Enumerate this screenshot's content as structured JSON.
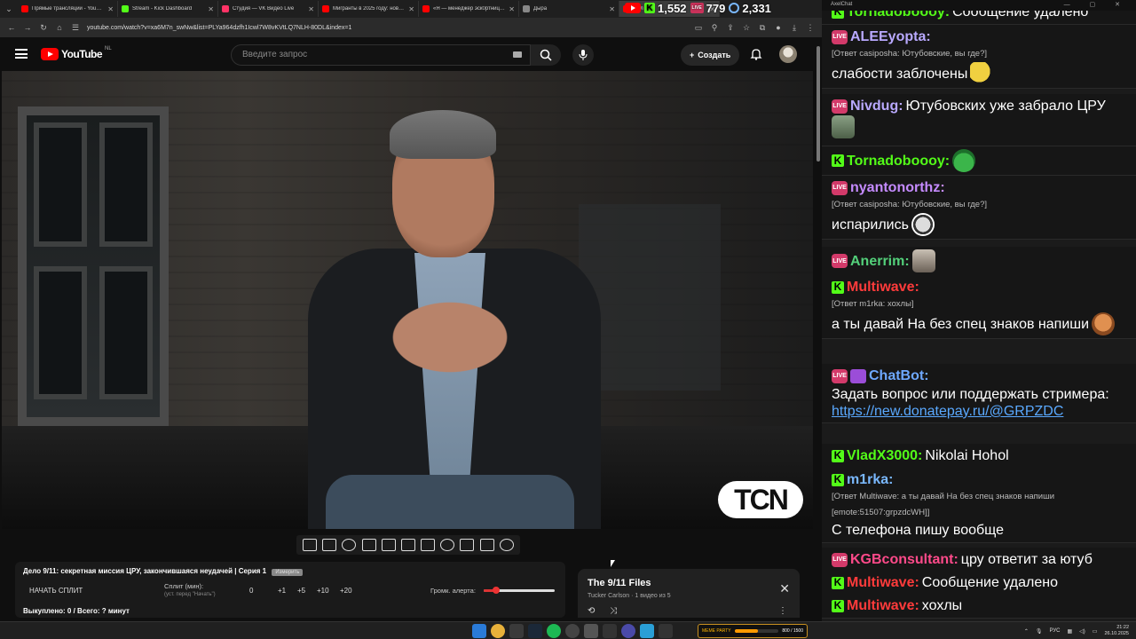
{
  "browser": {
    "tabs": [
      {
        "title": "Прямые трансляции - YouTube",
        "color": "#ff0000"
      },
      {
        "title": "Stream - Kick Dashboard",
        "color": "#53fc18"
      },
      {
        "title": "Студия — VK Видео Live",
        "color": "#ff3366"
      },
      {
        "title": "Мигранты в 2025 году: новы...",
        "color": "#ff0000"
      },
      {
        "title": "«Я — менеджер эск0ртниц»...",
        "color": "#ff0000"
      },
      {
        "title": "Дыра",
        "color": "#888888"
      },
      {
        "title": "Дел",
        "color": "#ff0000"
      }
    ],
    "url": "youtube.com/watch?v=xa6M7n_swNw&list=PLYa964dzfh1Icwl7W8vKVtLQ7NLH-80DL&index=1"
  },
  "youtube": {
    "logo_text": "YouTube",
    "region": "NL",
    "search_placeholder": "Введите запрос",
    "create_label": "Создать",
    "notifications_count": "116"
  },
  "video": {
    "watermark": "TCN"
  },
  "stream_stats": {
    "kick_viewers": "1,552",
    "vk_viewers": "779",
    "yt_viewers": "2,331"
  },
  "split_panel": {
    "title": "Дело 9/11: секретная миссия ЦРУ, закончившаяся неудачей | Серия 1",
    "badge": "Измерить",
    "start_button": "НАЧАТЬ СПЛИТ",
    "split_label": "Сплит (мин):",
    "split_sub": "(уст. перед \"Начать\")",
    "split_values": [
      "0",
      "+1",
      "+5",
      "+10",
      "+20"
    ],
    "alert_volume_label": "Громк. алерта:",
    "alert_volume": 0.18,
    "footer": "Выкуплено: 0 / Всего: ? минут"
  },
  "playlist": {
    "title": "The 9/11 Files",
    "subtitle": "Tucker Carlson · 1 видео из 5"
  },
  "chat": {
    "window_title": "AxelChat",
    "messages": [
      {
        "platform": "kick",
        "user": "Tornadobooоy:",
        "user_color": "#53fc18",
        "text": "Сообщение удалено"
      },
      {
        "platform": "live",
        "user": "ALEEyopta:",
        "user_color": "#b9a9ff",
        "reply": "[Ответ casiposha: Ютубовские, вы где?]",
        "text": "слабости заблочены",
        "emote": "pac"
      },
      {
        "platform": "live",
        "user": "Nivdug:",
        "user_color": "#b9a9ff",
        "text": "Ютубовских уже забрало ЦРУ",
        "emote": "zombie"
      },
      {
        "platform": "kick",
        "user": "Tornadobooоy:",
        "user_color": "#53fc18",
        "text": "",
        "emote": "frog"
      },
      {
        "platform": "live",
        "user": "nyantonorthz:",
        "user_color": "#c58bff",
        "reply": "[Ответ casiposha: Ютубовские, вы где?]",
        "text": "испарились",
        "emote": "ghost"
      },
      {
        "platform": "live",
        "user": "Anerrim:",
        "user_color": "#53d07a",
        "text": "",
        "emote": "cat"
      },
      {
        "platform": "kick",
        "user": "Multiwave:",
        "user_color": "#ff3b3b",
        "reply": "[Ответ m1rka: хохлы]",
        "text": "а ты давай На без спец знаков напиши",
        "emote": "tom"
      },
      {
        "platform": "live",
        "user": "ChatBot:",
        "user_color": "#6ea8ff",
        "text": "Задать вопрос или поддержать стримера:",
        "link": "https://new.donatepay.ru/@GRPZDC"
      },
      {
        "platform": "kick",
        "user": "VladX3000:",
        "user_color": "#53fc18",
        "text": "Nikolai Hohol"
      },
      {
        "platform": "kick",
        "user": "m1rka:",
        "user_color": "#7ab8ff",
        "reply": "[Ответ Multiwave: а ты давай На без спец знаков напиши",
        "reply2": "[emote:51507:grpzdcWH]]",
        "text": "С телефона пишу вообще"
      },
      {
        "platform": "live",
        "user": "KGBconsultant:",
        "user_color": "#ff4a8a",
        "text": "цру ответит за ютуб"
      },
      {
        "platform": "kick",
        "user": "Multiwave:",
        "user_color": "#ff3b3b",
        "text": "Сообщение удалено"
      },
      {
        "platform": "kick",
        "user": "Multiwave:",
        "user_color": "#ff3b3b",
        "text": "хохлы"
      }
    ]
  },
  "taskbar": {
    "meme_label": "MEME PARTY",
    "meme_progress": "800 / 1500",
    "meme_fraction": 0.53,
    "lang": "РУС",
    "time": "21:22",
    "date": "26.10.2025"
  }
}
